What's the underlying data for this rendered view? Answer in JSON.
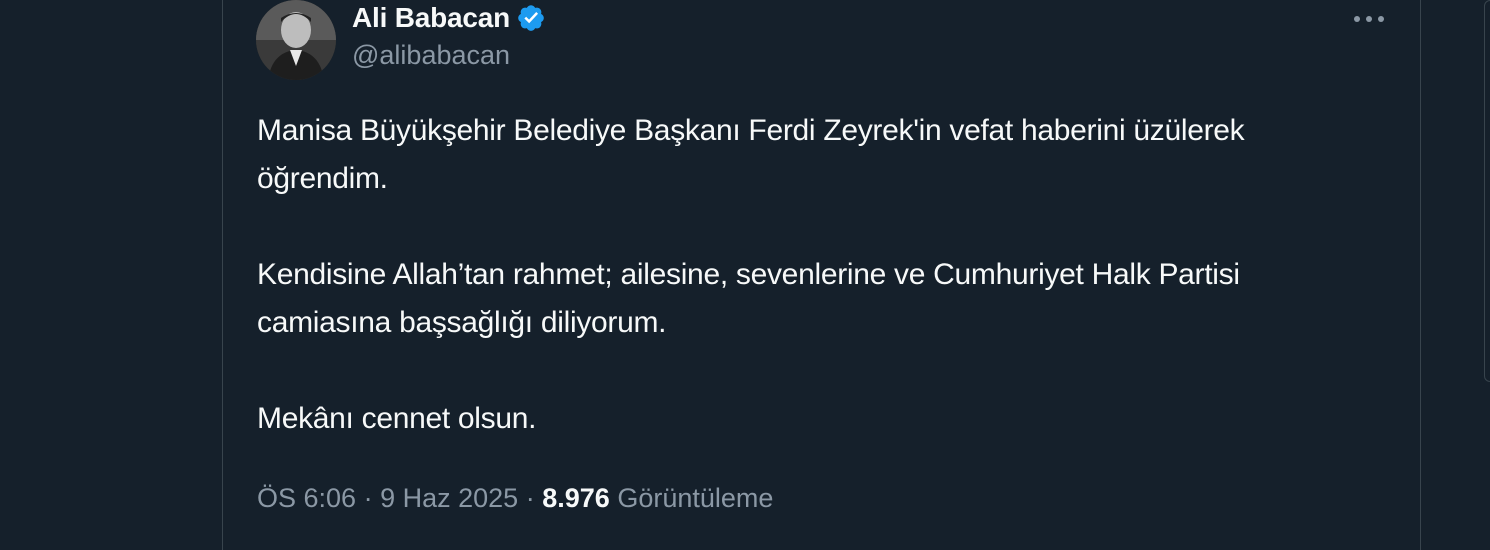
{
  "tweet": {
    "author": {
      "display_name": "Ali Babacan",
      "handle": "@alibabacan",
      "verified_icon": "verified-badge-icon",
      "avatar_icon": "avatar"
    },
    "more_icon": "more-options-icon",
    "paragraphs": [
      "Manisa Büyükşehir Belediye Başkanı Ferdi Zeyrek'in vefat haberini üzülerek öğrendim.",
      "Kendisine Allah’tan rahmet; ailesine, sevenlerine ve Cumhuriyet Halk Partisi camiasına başsağlığı diliyorum.",
      "Mekânı cennet olsun."
    ],
    "meta": {
      "time": "ÖS 6:06",
      "separator": "·",
      "date": "9 Haz 2025",
      "views_count": "8.976",
      "views_label": "Görüntüleme"
    }
  },
  "colors": {
    "background": "#15202b",
    "border": "#38444d",
    "text_primary": "#f7f9f9",
    "text_secondary": "#8b98a5",
    "verified_blue": "#1d9bf0"
  }
}
